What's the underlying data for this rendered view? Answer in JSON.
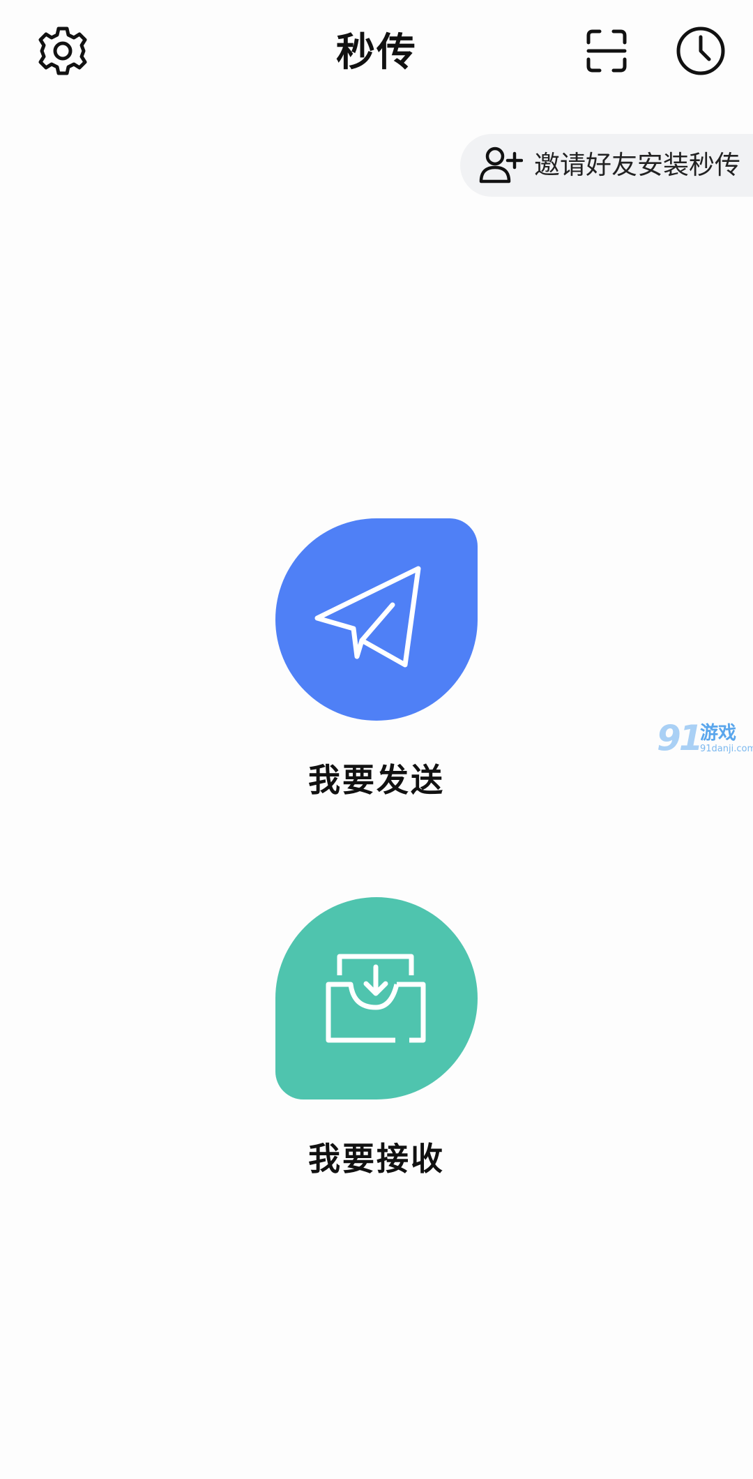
{
  "header": {
    "title": "秒传",
    "icons": [
      "gear-icon",
      "scan-icon",
      "clock-icon"
    ]
  },
  "invite": {
    "label": "邀请好友安装秒传",
    "icon": "person-add-icon"
  },
  "actions": [
    {
      "label": "我要发送",
      "icon": "paper-plane-icon",
      "color": "#4f80f6"
    },
    {
      "label": "我要接收",
      "icon": "inbox-download-icon",
      "color": "#4fc4ae"
    }
  ],
  "watermark": {
    "digits": "91",
    "word": "游戏",
    "site": "91danji.com"
  }
}
